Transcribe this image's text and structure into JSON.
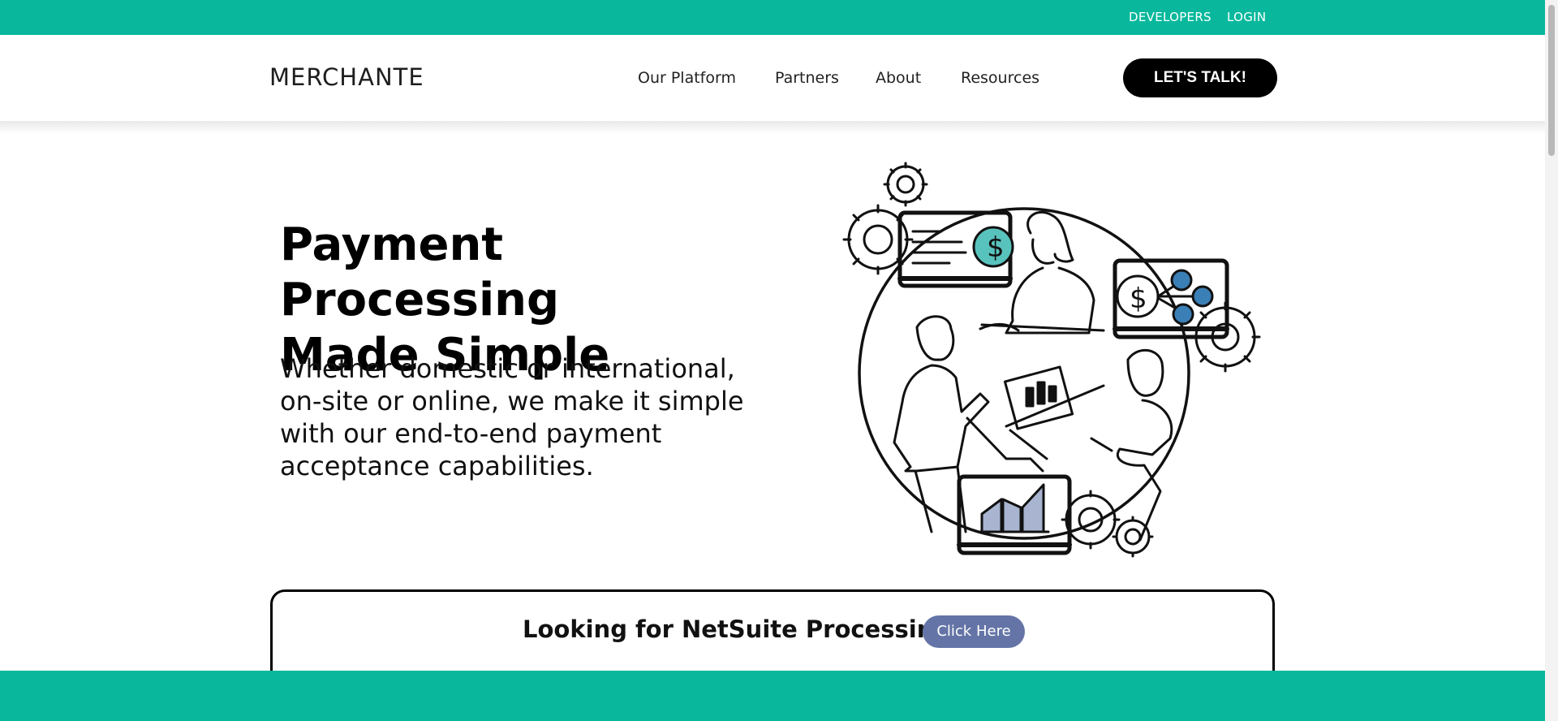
{
  "topbar": {
    "developers_label": "DEVELOPERS",
    "login_label": "LOGIN"
  },
  "header": {
    "logo_text": "MERCHANTE",
    "nav": [
      "Our Platform",
      "Partners",
      "About",
      "Resources"
    ],
    "cta_label": "LET'S TALK!"
  },
  "hero": {
    "title_line1": "Payment Processing",
    "title_line2": "Made Simple",
    "description": "Whether domestic or international, on-site or online, we make it simple with our end-to-end payment acceptance capabilities."
  },
  "netsuite": {
    "text": "Looking for NetSuite Processing?",
    "button_label": "Click Here"
  },
  "colors": {
    "brand_teal": "#09b89c",
    "button_blue": "#6474a6",
    "dark": "#000000"
  }
}
